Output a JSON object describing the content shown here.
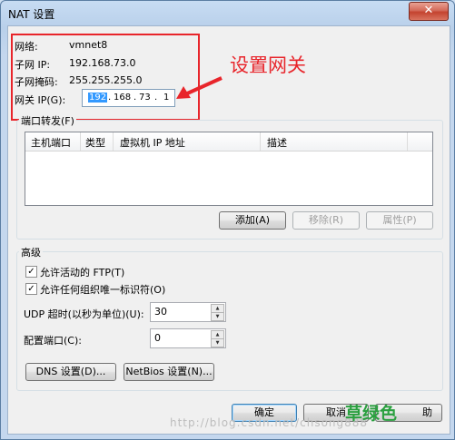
{
  "window": {
    "title": "NAT 设置",
    "close_icon": "close-icon"
  },
  "network": {
    "net_label": "网络:",
    "net_value": "vmnet8",
    "subnet_ip_label": "子网 IP:",
    "subnet_ip_value": "192.168.73.0",
    "mask_label": "子网掩码:",
    "mask_value": "255.255.255.0",
    "gateway_label": "网关 IP(G):",
    "gateway_octets": [
      "192",
      "168",
      "73",
      "1"
    ]
  },
  "annotation": {
    "text": "设置网关",
    "color": "#e8252b"
  },
  "port_forwarding": {
    "group_label": "端口转发(F)",
    "columns": [
      "主机端口",
      "类型",
      "虚拟机 IP 地址",
      "描述"
    ],
    "rows": [],
    "add_label": "添加(A)",
    "remove_label": "移除(R)",
    "properties_label": "属性(P)"
  },
  "advanced": {
    "group_label": "高级",
    "allow_ftp_label": "允许活动的 FTP(T)",
    "allow_ftp_checked": true,
    "allow_oui_label": "允许任何组织唯一标识符(O)",
    "allow_oui_checked": true,
    "udp_timeout_label": "UDP 超时(以秒为单位)(U):",
    "udp_timeout_value": "30",
    "config_port_label": "配置端口(C):",
    "config_port_value": "0",
    "dns_label": "DNS 设置(D)...",
    "netbios_label": "NetBios 设置(N)..."
  },
  "footer": {
    "ok_label": "确定",
    "cancel_label": "取消",
    "help_label_partial": "助"
  },
  "watermark": {
    "url": "http://blog.csdn.net/chsong888",
    "logo": "草绿色"
  }
}
